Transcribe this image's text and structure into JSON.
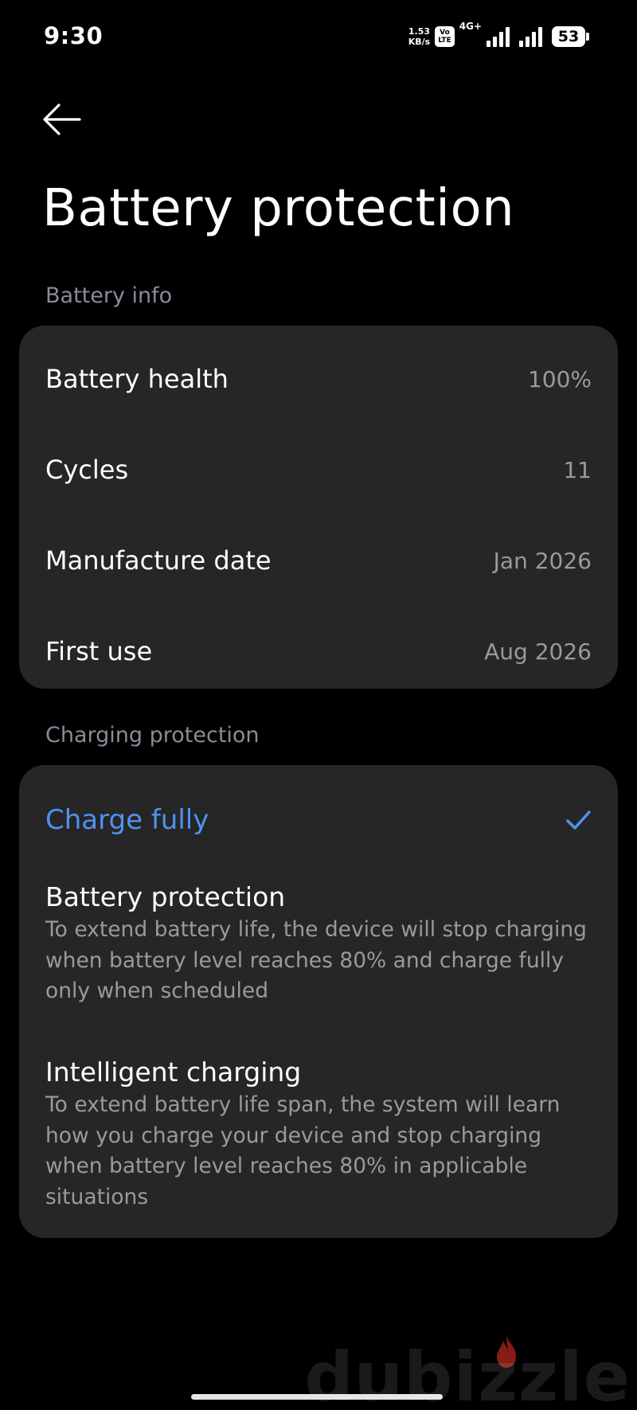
{
  "status_bar": {
    "time": "9:30",
    "net_speed_value": "1.53",
    "net_speed_unit": "KB/s",
    "volte_top": "Vo",
    "volte_bottom": "LTE",
    "network_type": "4G+",
    "battery_level": "53"
  },
  "header": {
    "back_icon": "arrow-left-icon",
    "title": "Battery protection"
  },
  "battery_info": {
    "section_label": "Battery info",
    "rows": [
      {
        "label": "Battery health",
        "value": "100%"
      },
      {
        "label": "Cycles",
        "value": "11"
      },
      {
        "label": "Manufacture date",
        "value": "Jan 2026"
      },
      {
        "label": "First use",
        "value": "Aug 2026"
      }
    ]
  },
  "charging_protection": {
    "section_label": "Charging protection",
    "options": [
      {
        "title": "Charge fully",
        "selected": true,
        "description": ""
      },
      {
        "title": "Battery protection",
        "selected": false,
        "description": "To extend battery life, the device will stop charging when battery level reaches 80% and charge fully only when scheduled"
      },
      {
        "title": "Intelligent charging",
        "selected": false,
        "description": "To extend battery life span, the system will learn how you charge your device and stop charging when battery level reaches 80% in applicable situations"
      }
    ]
  },
  "watermark": "dubizzle",
  "colors": {
    "background": "#000000",
    "card": "#262626",
    "accent": "#4e92f2",
    "secondary_text": "#9a9a9a",
    "section_label": "#8a8a99"
  }
}
